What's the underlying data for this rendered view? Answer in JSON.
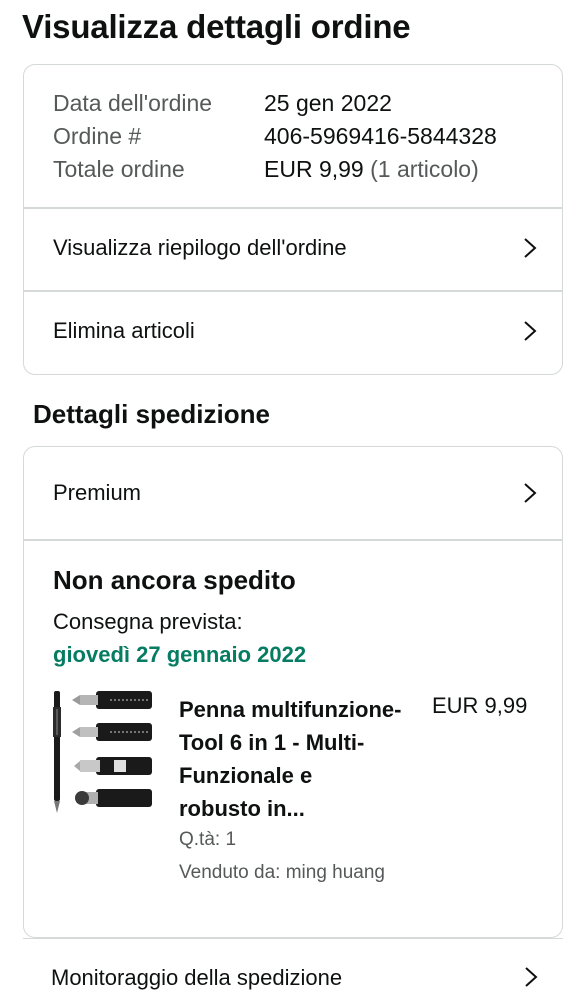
{
  "page": {
    "title": "Visualizza dettagli ordine"
  },
  "order_summary": {
    "date_label": "Data dell'ordine",
    "date_value": "25 gen 2022",
    "number_label": "Ordine #",
    "number_value": "406-5969416-5844328",
    "total_label": "Totale ordine",
    "total_value": "EUR 9,99",
    "total_items": "(1 articolo)",
    "view_summary_label": "Visualizza riepilogo dell'ordine",
    "delete_items_label": "Elimina articoli"
  },
  "shipping": {
    "section_title": "Dettagli spedizione",
    "service_label": "Premium",
    "status": "Non ancora spedito",
    "delivery_label": "Consegna prevista:",
    "delivery_date": "giovedì 27 gennaio 2022",
    "delivery_date_color": "#067d62",
    "item": {
      "title": "Penna multifunzione- Tool 6 in 1 - Multi-Funzionale e robusto in...",
      "title_lines": [
        "Penna multifunzione-",
        "Tool 6 in 1 - Multi-",
        "Funzionale e",
        "robusto in..."
      ],
      "price": "EUR 9,99",
      "quantity": "Q.tà: 1",
      "seller": "Venduto da: ming huang",
      "image_icon": "multitool-pen-image"
    },
    "tracking_label": "Monitoraggio della spedizione"
  },
  "icons": {
    "chevron": "chevron-right-icon"
  },
  "colors": {
    "border": "#d5d9d9",
    "muted_text": "#565959",
    "primary_text": "#0f1111"
  }
}
